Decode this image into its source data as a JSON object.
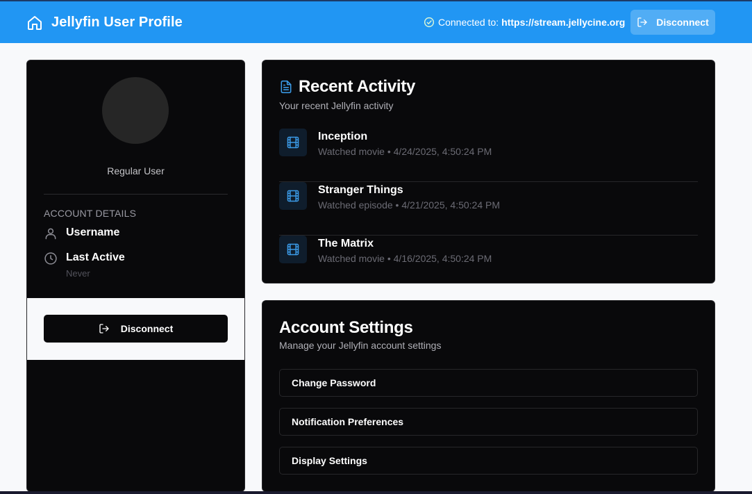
{
  "header": {
    "title": "Jellyfin User Profile",
    "connected_label": "Connected to:",
    "server_url": "https://stream.jellycine.org",
    "disconnect_label": "Disconnect"
  },
  "profile": {
    "role": "Regular User",
    "section_title": "ACCOUNT DETAILS",
    "username_label": "Username",
    "last_active_label": "Last Active",
    "last_active_value": "Never",
    "disconnect_label": "Disconnect"
  },
  "activity": {
    "title": "Recent Activity",
    "subtitle": "Your recent Jellyfin activity",
    "items": [
      {
        "title": "Inception",
        "meta": "Watched movie • 4/24/2025, 4:50:24 PM"
      },
      {
        "title": "Stranger Things",
        "meta": "Watched episode • 4/21/2025, 4:50:24 PM"
      },
      {
        "title": "The Matrix",
        "meta": "Watched movie • 4/16/2025, 4:50:24 PM"
      }
    ]
  },
  "settings": {
    "title": "Account Settings",
    "subtitle": "Manage your Jellyfin account settings",
    "buttons": [
      "Change Password",
      "Notification Preferences",
      "Display Settings"
    ]
  },
  "icons": {
    "home": "home-icon",
    "check": "check-circle-icon",
    "logout": "logout-icon",
    "user": "user-icon",
    "clock": "clock-icon",
    "document": "document-icon",
    "film": "film-icon"
  },
  "colors": {
    "header_bg": "#2196f3",
    "card_bg": "#09090b",
    "accent_blue": "#3b9be8"
  }
}
